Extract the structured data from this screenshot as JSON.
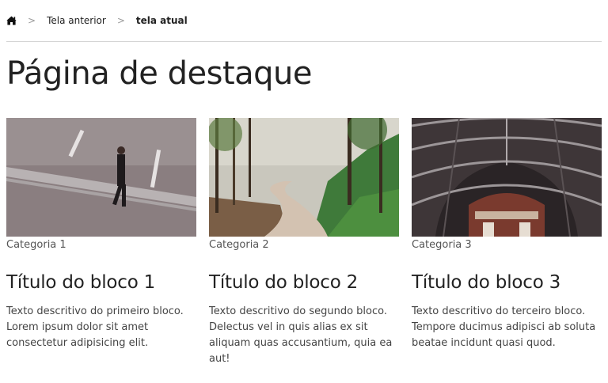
{
  "breadcrumb": {
    "home_icon": "home-icon",
    "separator": ">",
    "previous": "Tela anterior",
    "current": "tela atual"
  },
  "page_title": "Página de destaque",
  "cards": [
    {
      "category": "Categoria 1",
      "title": "Título do bloco 1",
      "description": "Texto descritivo do primeiro bloco. Lorem ipsum dolor sit amet consectetur adipisicing elit.",
      "image": "man-walking-street-photo"
    },
    {
      "category": "Categoria 2",
      "title": "Título do bloco 2",
      "description": "Texto descritivo do segundo bloco. Delectus vel in quis alias ex sit aliquam quas accusantium, quia ea aut!",
      "image": "forest-path-photo"
    },
    {
      "category": "Categoria 3",
      "title": "Título do bloco 3",
      "description": "Texto descritivo do terceiro bloco. Tempore ducimus adipisci ab soluta beatae incidunt quasi quod.",
      "image": "station-roof-photo"
    }
  ]
}
